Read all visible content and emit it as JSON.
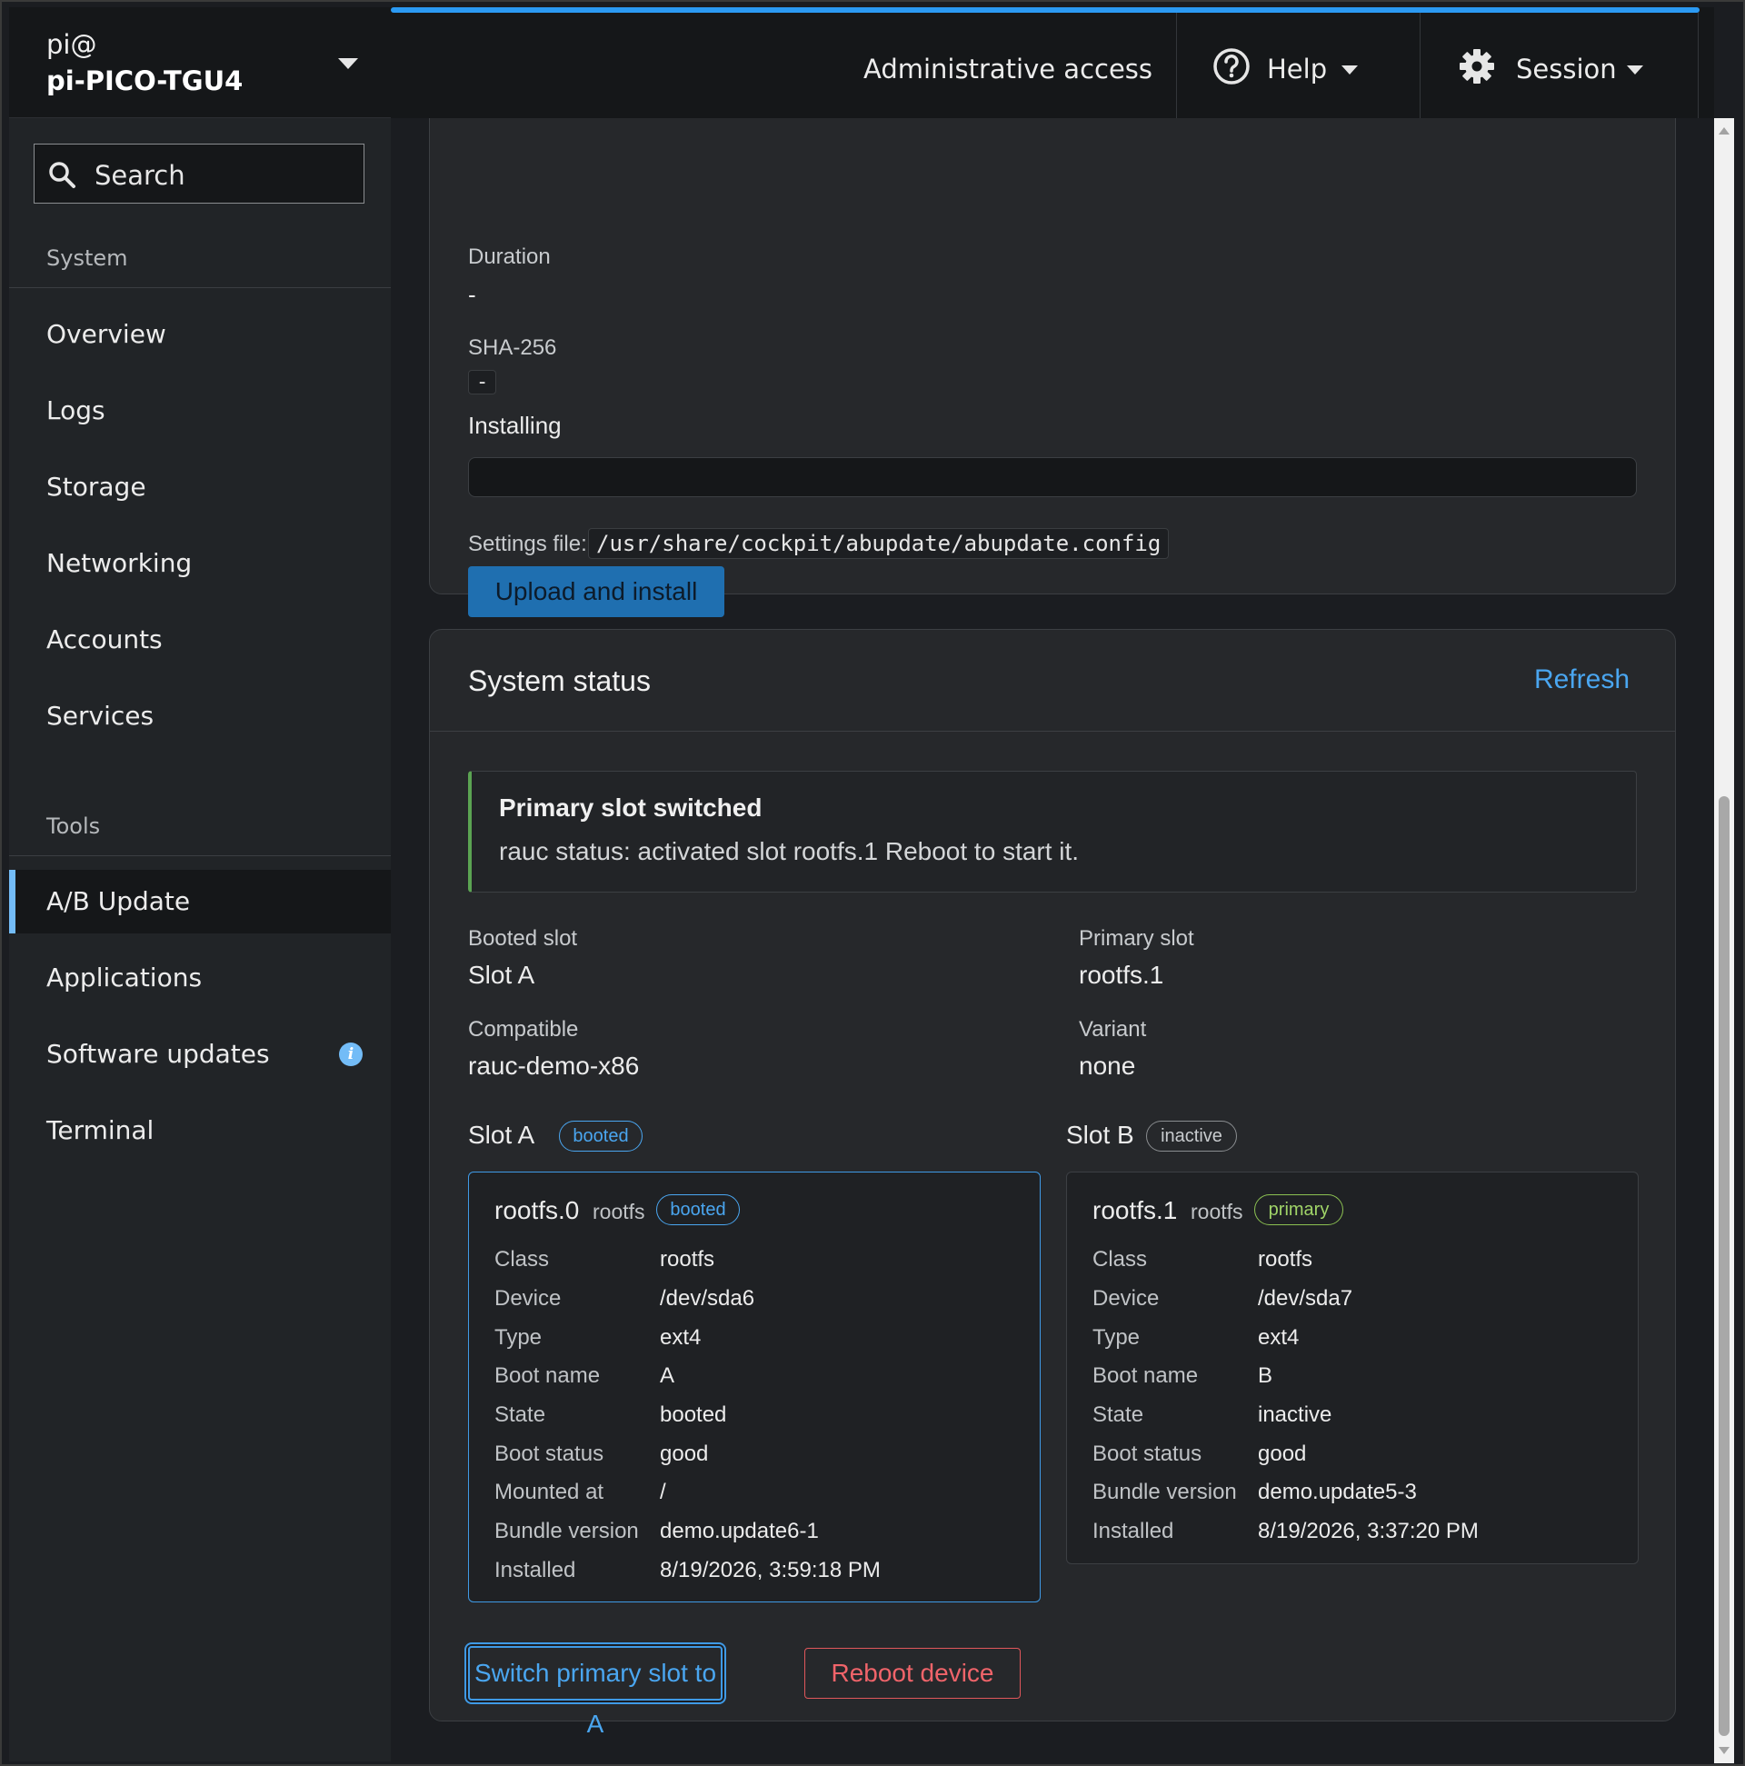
{
  "host": {
    "user": "pi@",
    "name": "pi-PICO-TGU4"
  },
  "search": {
    "label": "Search"
  },
  "sidebar": {
    "system_title": "System",
    "system_items": [
      {
        "label": "Overview"
      },
      {
        "label": "Logs"
      },
      {
        "label": "Storage"
      },
      {
        "label": "Networking"
      },
      {
        "label": "Accounts"
      },
      {
        "label": "Services"
      }
    ],
    "tools_title": "Tools",
    "tools_items": [
      {
        "label": "A/B Update",
        "active": true
      },
      {
        "label": "Applications"
      },
      {
        "label": "Software updates",
        "badge": "i"
      },
      {
        "label": "Terminal"
      }
    ]
  },
  "topbar": {
    "admin_label": "Administrative access",
    "help_label": "Help",
    "session_label": "Session",
    "accent_color": "#2b9af3"
  },
  "upload_card": {
    "duration_label": "Duration",
    "duration_value": "-",
    "sha_label": "SHA-256",
    "sha_value": "-",
    "installing_label": "Installing",
    "settings_label": "Settings file:",
    "settings_path": "/usr/share/cockpit/abupdate/abupdate.config",
    "upload_button": "Upload and install"
  },
  "status_card": {
    "title": "System status",
    "refresh": "Refresh",
    "alert_title": "Primary slot switched",
    "alert_body": "rauc status: activated slot rootfs.1 Reboot to start it.",
    "booted_slot_label": "Booted slot",
    "booted_slot_value": "Slot A",
    "primary_slot_label": "Primary slot",
    "primary_slot_value": "rootfs.1",
    "compatible_label": "Compatible",
    "compatible_value": "rauc-demo-x86",
    "variant_label": "Variant",
    "variant_value": "none",
    "slot_a": {
      "heading": "Slot A",
      "heading_badge": "booted",
      "name": "rootfs.0",
      "class_sub": "rootfs",
      "badge": "booted",
      "rows": [
        {
          "k": "Class",
          "v": "rootfs"
        },
        {
          "k": "Device",
          "v": "/dev/sda6"
        },
        {
          "k": "Type",
          "v": "ext4"
        },
        {
          "k": "Boot name",
          "v": "A"
        },
        {
          "k": "State",
          "v": "booted"
        },
        {
          "k": "Boot status",
          "v": "good"
        },
        {
          "k": "Mounted at",
          "v": "/"
        },
        {
          "k": "Bundle version",
          "v": "demo.update6-1"
        },
        {
          "k": "Installed",
          "v": "8/19/2026, 3:59:18 PM"
        }
      ]
    },
    "slot_b": {
      "heading": "Slot B",
      "heading_badge": "inactive",
      "name": "rootfs.1",
      "class_sub": "rootfs",
      "badge": "primary",
      "rows": [
        {
          "k": "Class",
          "v": "rootfs"
        },
        {
          "k": "Device",
          "v": "/dev/sda7"
        },
        {
          "k": "Type",
          "v": "ext4"
        },
        {
          "k": "Boot name",
          "v": "B"
        },
        {
          "k": "State",
          "v": "inactive"
        },
        {
          "k": "Boot status",
          "v": "good"
        },
        {
          "k": "Bundle version",
          "v": "demo.update5-3"
        },
        {
          "k": "Installed",
          "v": "8/19/2026, 3:37:20 PM"
        }
      ]
    },
    "switch_button": "Switch primary slot to A",
    "reboot_button": "Reboot device"
  }
}
